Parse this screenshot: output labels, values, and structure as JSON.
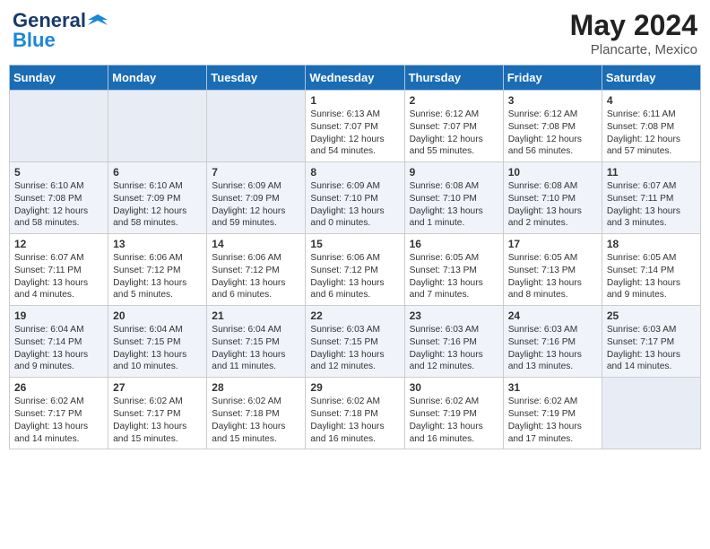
{
  "header": {
    "logo_line1": "General",
    "logo_line2": "Blue",
    "month": "May 2024",
    "location": "Plancarte, Mexico"
  },
  "weekdays": [
    "Sunday",
    "Monday",
    "Tuesday",
    "Wednesday",
    "Thursday",
    "Friday",
    "Saturday"
  ],
  "weeks": [
    [
      {
        "day": "",
        "info": ""
      },
      {
        "day": "",
        "info": ""
      },
      {
        "day": "",
        "info": ""
      },
      {
        "day": "1",
        "info": "Sunrise: 6:13 AM\nSunset: 7:07 PM\nDaylight: 12 hours\nand 54 minutes."
      },
      {
        "day": "2",
        "info": "Sunrise: 6:12 AM\nSunset: 7:07 PM\nDaylight: 12 hours\nand 55 minutes."
      },
      {
        "day": "3",
        "info": "Sunrise: 6:12 AM\nSunset: 7:08 PM\nDaylight: 12 hours\nand 56 minutes."
      },
      {
        "day": "4",
        "info": "Sunrise: 6:11 AM\nSunset: 7:08 PM\nDaylight: 12 hours\nand 57 minutes."
      }
    ],
    [
      {
        "day": "5",
        "info": "Sunrise: 6:10 AM\nSunset: 7:08 PM\nDaylight: 12 hours\nand 58 minutes."
      },
      {
        "day": "6",
        "info": "Sunrise: 6:10 AM\nSunset: 7:09 PM\nDaylight: 12 hours\nand 58 minutes."
      },
      {
        "day": "7",
        "info": "Sunrise: 6:09 AM\nSunset: 7:09 PM\nDaylight: 12 hours\nand 59 minutes."
      },
      {
        "day": "8",
        "info": "Sunrise: 6:09 AM\nSunset: 7:10 PM\nDaylight: 13 hours\nand 0 minutes."
      },
      {
        "day": "9",
        "info": "Sunrise: 6:08 AM\nSunset: 7:10 PM\nDaylight: 13 hours\nand 1 minute."
      },
      {
        "day": "10",
        "info": "Sunrise: 6:08 AM\nSunset: 7:10 PM\nDaylight: 13 hours\nand 2 minutes."
      },
      {
        "day": "11",
        "info": "Sunrise: 6:07 AM\nSunset: 7:11 PM\nDaylight: 13 hours\nand 3 minutes."
      }
    ],
    [
      {
        "day": "12",
        "info": "Sunrise: 6:07 AM\nSunset: 7:11 PM\nDaylight: 13 hours\nand 4 minutes."
      },
      {
        "day": "13",
        "info": "Sunrise: 6:06 AM\nSunset: 7:12 PM\nDaylight: 13 hours\nand 5 minutes."
      },
      {
        "day": "14",
        "info": "Sunrise: 6:06 AM\nSunset: 7:12 PM\nDaylight: 13 hours\nand 6 minutes."
      },
      {
        "day": "15",
        "info": "Sunrise: 6:06 AM\nSunset: 7:12 PM\nDaylight: 13 hours\nand 6 minutes."
      },
      {
        "day": "16",
        "info": "Sunrise: 6:05 AM\nSunset: 7:13 PM\nDaylight: 13 hours\nand 7 minutes."
      },
      {
        "day": "17",
        "info": "Sunrise: 6:05 AM\nSunset: 7:13 PM\nDaylight: 13 hours\nand 8 minutes."
      },
      {
        "day": "18",
        "info": "Sunrise: 6:05 AM\nSunset: 7:14 PM\nDaylight: 13 hours\nand 9 minutes."
      }
    ],
    [
      {
        "day": "19",
        "info": "Sunrise: 6:04 AM\nSunset: 7:14 PM\nDaylight: 13 hours\nand 9 minutes."
      },
      {
        "day": "20",
        "info": "Sunrise: 6:04 AM\nSunset: 7:15 PM\nDaylight: 13 hours\nand 10 minutes."
      },
      {
        "day": "21",
        "info": "Sunrise: 6:04 AM\nSunset: 7:15 PM\nDaylight: 13 hours\nand 11 minutes."
      },
      {
        "day": "22",
        "info": "Sunrise: 6:03 AM\nSunset: 7:15 PM\nDaylight: 13 hours\nand 12 minutes."
      },
      {
        "day": "23",
        "info": "Sunrise: 6:03 AM\nSunset: 7:16 PM\nDaylight: 13 hours\nand 12 minutes."
      },
      {
        "day": "24",
        "info": "Sunrise: 6:03 AM\nSunset: 7:16 PM\nDaylight: 13 hours\nand 13 minutes."
      },
      {
        "day": "25",
        "info": "Sunrise: 6:03 AM\nSunset: 7:17 PM\nDaylight: 13 hours\nand 14 minutes."
      }
    ],
    [
      {
        "day": "26",
        "info": "Sunrise: 6:02 AM\nSunset: 7:17 PM\nDaylight: 13 hours\nand 14 minutes."
      },
      {
        "day": "27",
        "info": "Sunrise: 6:02 AM\nSunset: 7:17 PM\nDaylight: 13 hours\nand 15 minutes."
      },
      {
        "day": "28",
        "info": "Sunrise: 6:02 AM\nSunset: 7:18 PM\nDaylight: 13 hours\nand 15 minutes."
      },
      {
        "day": "29",
        "info": "Sunrise: 6:02 AM\nSunset: 7:18 PM\nDaylight: 13 hours\nand 16 minutes."
      },
      {
        "day": "30",
        "info": "Sunrise: 6:02 AM\nSunset: 7:19 PM\nDaylight: 13 hours\nand 16 minutes."
      },
      {
        "day": "31",
        "info": "Sunrise: 6:02 AM\nSunset: 7:19 PM\nDaylight: 13 hours\nand 17 minutes."
      },
      {
        "day": "",
        "info": ""
      }
    ]
  ]
}
